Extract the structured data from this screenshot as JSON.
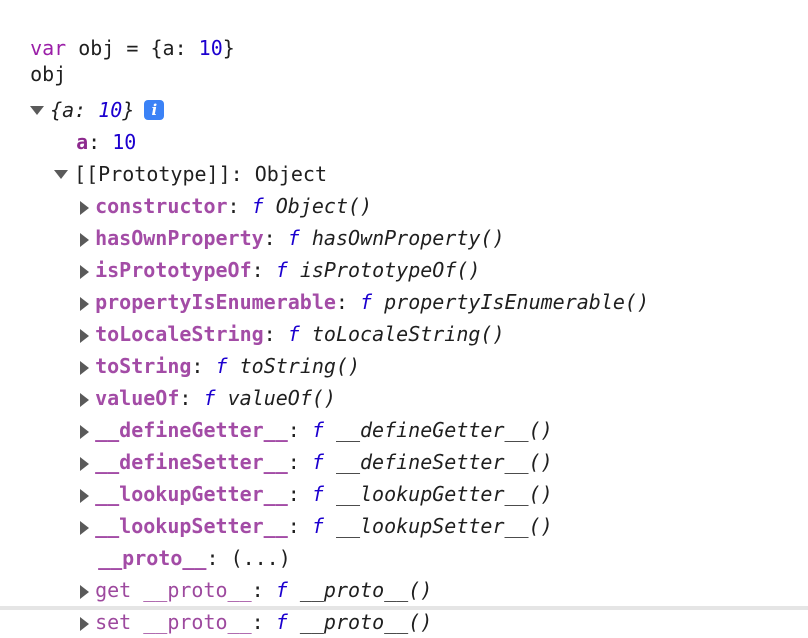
{
  "input": {
    "kw": "var",
    "rest": " obj = {a: ",
    "num": "10",
    "close": "}"
  },
  "echo": "obj",
  "root": {
    "preview_open": "{a: ",
    "preview_num": "10",
    "preview_close": "}",
    "info_glyph": "i"
  },
  "prop_a": {
    "key": "a",
    "value": "10"
  },
  "prototype": {
    "label": "[[Prototype]]",
    "value": "Object"
  },
  "methods": [
    {
      "key": "constructor",
      "f": "f",
      "name": "Object()"
    },
    {
      "key": "hasOwnProperty",
      "f": "f",
      "name": "hasOwnProperty()"
    },
    {
      "key": "isPrototypeOf",
      "f": "f",
      "name": "isPrototypeOf()"
    },
    {
      "key": "propertyIsEnumerable",
      "f": "f",
      "name": "propertyIsEnumerable()"
    },
    {
      "key": "toLocaleString",
      "f": "f",
      "name": "toLocaleString()"
    },
    {
      "key": "toString",
      "f": "f",
      "name": "toString()"
    },
    {
      "key": "valueOf",
      "f": "f",
      "name": "valueOf()"
    },
    {
      "key": "__defineGetter__",
      "f": "f",
      "name": "__defineGetter__()"
    },
    {
      "key": "__defineSetter__",
      "f": "f",
      "name": "__defineSetter__()"
    },
    {
      "key": "__lookupGetter__",
      "f": "f",
      "name": "__lookupGetter__()"
    },
    {
      "key": "__lookupSetter__",
      "f": "f",
      "name": "__lookupSetter__()"
    }
  ],
  "proto_prop": {
    "key": "__proto__",
    "value": "(...)"
  },
  "accessors": [
    {
      "prefix": "get",
      "key": "__proto__",
      "f": "f",
      "name": "__proto__()"
    },
    {
      "prefix": "set",
      "key": "__proto__",
      "f": "f",
      "name": "__proto__()"
    }
  ],
  "icons": [
    "expand-down-icon",
    "expand-right-icon",
    "info-icon"
  ]
}
